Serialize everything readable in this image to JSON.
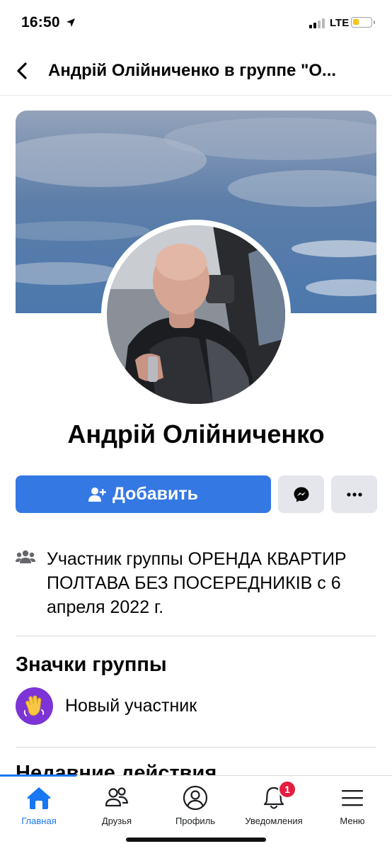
{
  "status_bar": {
    "time": "16:50",
    "network": "LTE"
  },
  "nav": {
    "title": "Андрій Олійниченко в группе \"О..."
  },
  "profile": {
    "name": "Андрій Олійниченко",
    "add_label": "Добавить"
  },
  "membership": {
    "prefix": "Участник группы ",
    "group_name": "ОРЕНДА КВАРТИР ПОЛТАВА БЕЗ ПОСЕРЕДНИКІВ",
    "suffix": " с 6 апреля 2022 г."
  },
  "badges": {
    "title": "Значки группы",
    "items": [
      {
        "label": "Новый участник",
        "icon": "waving-hand-icon"
      }
    ]
  },
  "recent": {
    "title": "Недавние действия"
  },
  "tabbar": {
    "tabs": [
      {
        "label": "Главная",
        "icon": "home-icon",
        "active": true
      },
      {
        "label": "Друзья",
        "icon": "friends-icon"
      },
      {
        "label": "Профиль",
        "icon": "profile-icon"
      },
      {
        "label": "Уведомления",
        "icon": "bell-icon",
        "badge": "1"
      },
      {
        "label": "Меню",
        "icon": "menu-icon"
      }
    ]
  },
  "colors": {
    "primary": "#3478e4",
    "accent": "#1877f2",
    "badge_bg": "#7d34d6",
    "notification": "#e41e3f"
  }
}
